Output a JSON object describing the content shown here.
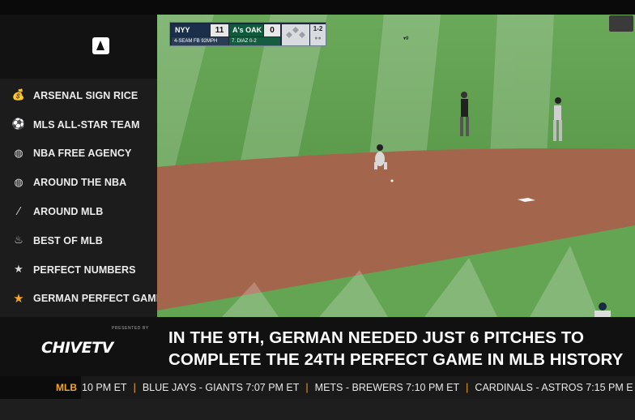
{
  "sidebar": {
    "logo_icon": "a-logo-icon",
    "items": [
      {
        "label": "ARSENAL SIGN RICE",
        "icon": "money-bag-icon",
        "glyph": "💰",
        "active": false
      },
      {
        "label": "MLS ALL-STAR TEAM",
        "icon": "soccer-ball-icon",
        "glyph": "⚽",
        "active": false
      },
      {
        "label": "NBA FREE AGENCY",
        "icon": "basketball-icon",
        "glyph": "◍",
        "active": false
      },
      {
        "label": "AROUND THE NBA",
        "icon": "basketball-icon",
        "glyph": "◍",
        "active": false
      },
      {
        "label": "AROUND MLB",
        "icon": "baseball-bat-icon",
        "glyph": "⁄",
        "active": false
      },
      {
        "label": "BEST OF MLB",
        "icon": "fire-icon",
        "glyph": "♨",
        "active": false
      },
      {
        "label": "PERFECT NUMBERS",
        "icon": "star-icon",
        "glyph": "★",
        "active": false
      },
      {
        "label": "GERMAN PERFECT GAME",
        "icon": "star-icon",
        "glyph": "★",
        "active": true
      }
    ]
  },
  "scorebug": {
    "team1": "NYY",
    "score1": "11",
    "team2": "A's OAK",
    "score2": "0",
    "pitch_info": "4-SEAM FB   92MPH",
    "pitcher": "7. DIAZ    0-2",
    "inning": "▾9",
    "count": "1-2"
  },
  "caption": {
    "presented_by": "PRESENTED BY",
    "brand": "CHIVETV",
    "headline_line1": "IN THE 9TH, GERMAN NEEDED JUST 6 PITCHES TO",
    "headline_line2": "COMPLETE THE 24TH PERFECT GAME IN MLB HISTORY"
  },
  "ticker": {
    "league": "MLB",
    "games": [
      "10 PM ET",
      "BLUE JAYS - GIANTS 7:07 PM ET",
      "METS - BREWERS 7:10 PM ET",
      "CARDINALS - ASTROS 7:15 PM E"
    ]
  },
  "colors": {
    "accent": "#f5a623",
    "sidebar_bg": "#1c1c1c",
    "field_grass": "#5a9a4a",
    "infield_dirt": "#a0644a"
  }
}
